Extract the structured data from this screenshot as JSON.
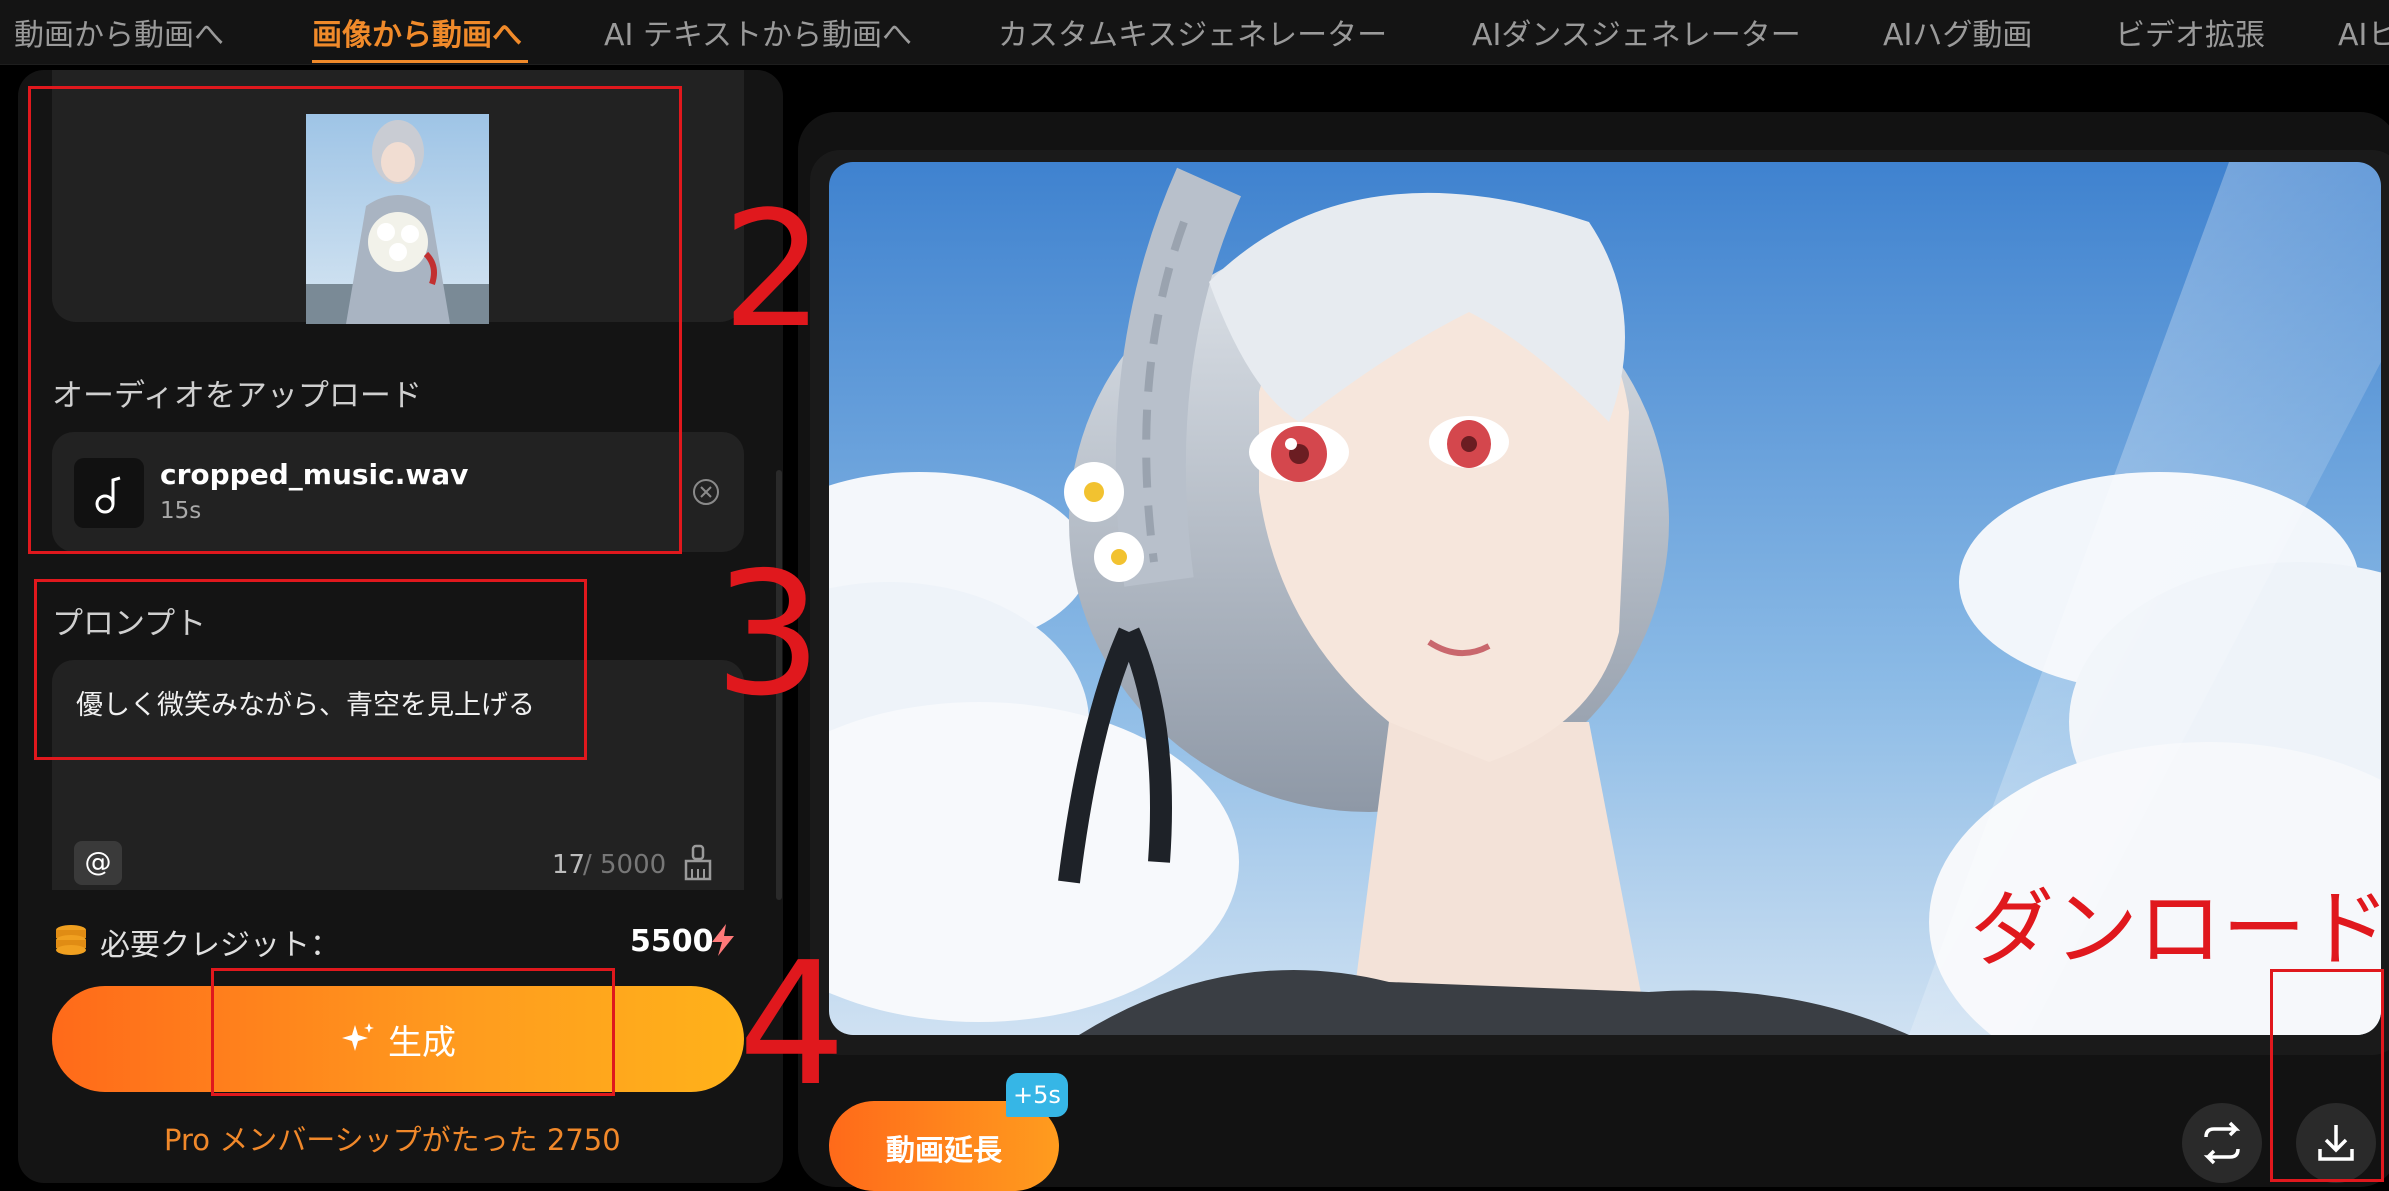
{
  "nav": {
    "items": [
      {
        "label": "動画から動画へ"
      },
      {
        "label": "画像から動画へ"
      },
      {
        "label": "AI テキストから動画へ"
      },
      {
        "label": "カスタムキスジェネレーター"
      },
      {
        "label": "AIダンスジェネレーター"
      },
      {
        "label": "AIハグ動画"
      },
      {
        "label": "ビデオ拡張"
      },
      {
        "label": "AIヒ"
      }
    ],
    "active": "画像から動画へ"
  },
  "audio": {
    "section_label": "オーディオをアップロード",
    "file_name": "cropped_music.wav",
    "duration": "15s"
  },
  "prompt": {
    "section_label": "プロンプト",
    "text": "優しく微笑みながら、青空を見上げる",
    "at_label": "@",
    "count": "17",
    "separator": "/",
    "max": "5000"
  },
  "credits": {
    "label": "必要クレジット：",
    "value": "5500"
  },
  "generate": {
    "label": "生成"
  },
  "pro_text": "Pro メンバーシップがたった 2750",
  "extend": {
    "label": "動画延長",
    "badge": "+5s"
  },
  "annotations": {
    "step2": "2",
    "step3": "3",
    "step4": "4",
    "download": "ダンロード"
  },
  "colors": {
    "accent": "#f08a2a",
    "annotation_red": "#e0181d",
    "badge_blue": "#36b6e6",
    "panel": "#141414"
  },
  "icons": [
    "music-note-icon",
    "close-circle-icon",
    "brush-icon",
    "coin-stack-icon",
    "lightning-icon",
    "sparkle-icon",
    "repeat-icon",
    "download-icon"
  ]
}
